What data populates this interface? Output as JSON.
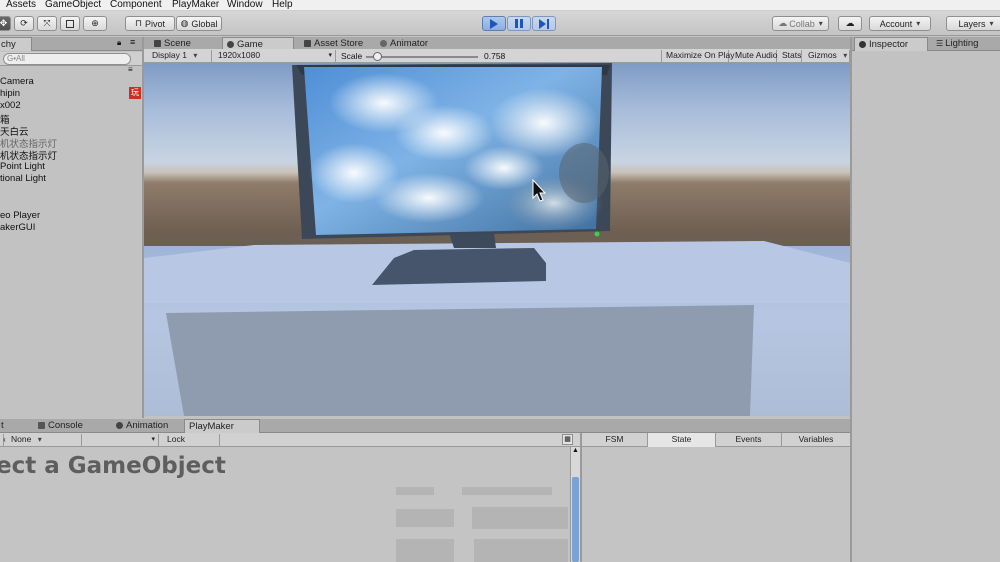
{
  "menu": [
    "Assets",
    "GameObject",
    "Component",
    "PlayMaker",
    "Window",
    "Help"
  ],
  "toolbar": {
    "pivot_label": "Pivot",
    "global_label": "Global",
    "collab_label": "Collab",
    "account_label": "Account",
    "layers_label": "Layers"
  },
  "hierarchy": {
    "tab_label": "chy",
    "search_placeholder": "G•All",
    "items": [
      "Camera",
      "hipin",
      "x002",
      "箱",
      "天白云",
      "机状态指示灯",
      "机状态指示灯",
      "Point Light",
      "tional Light",
      "",
      "eo Player",
      "akerGUI"
    ],
    "badge": "玩"
  },
  "center_tabs": [
    "Scene",
    "Game",
    "Asset Store",
    "Animator"
  ],
  "game": {
    "display": "Display 1",
    "resolution": "1920x1080",
    "scale_label": "Scale",
    "scale_value": "0.758",
    "scale_fraction": 0.1,
    "buttons": [
      "Maximize On Play",
      "Mute Audio",
      "Stats",
      "Gizmos"
    ]
  },
  "inspector": {
    "tab_label": "Inspector",
    "lighting_label": "Lighting"
  },
  "bottom": {
    "tabs": [
      "Console",
      "Animation",
      "PlayMaker"
    ],
    "none_label": "None",
    "lock_label": "Lock",
    "select_text": "ect a GameObject",
    "fsm_tabs": [
      "FSM",
      "State",
      "Events",
      "Variables"
    ]
  },
  "colors": {
    "play_accent": "#1f55b8",
    "sky": "#a9bedb",
    "floor": "#b6c6e2"
  }
}
